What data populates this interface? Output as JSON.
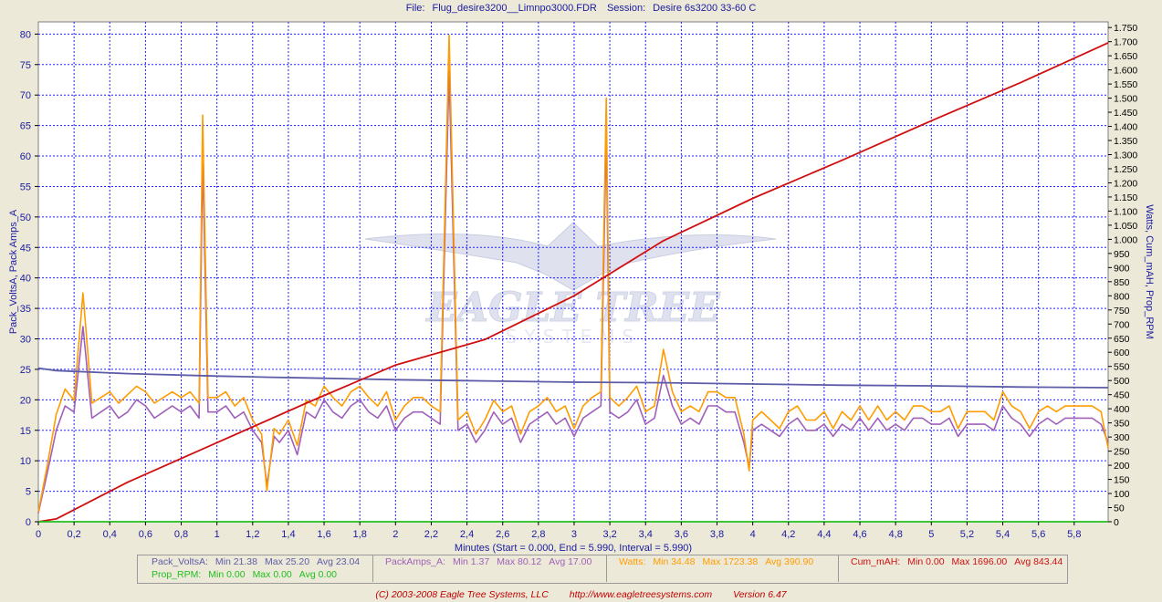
{
  "header": {
    "file_label": "File:",
    "file_name": "Flug_desire3200__Limnpo3000.FDR",
    "session_label": "Session:",
    "session_name": "Desire 6s3200 33-60 C"
  },
  "colors": {
    "volts": "#5c5ca8",
    "amps": "#a060b8",
    "watts": "#ff9c00",
    "mah": "#d01010",
    "rpm": "#20c020",
    "grid": "#2020ff",
    "axis_text": "#1a1aa0",
    "plot_bg": "#ffffff",
    "window_bg": "#ece9d8"
  },
  "chart_data": {
    "type": "line",
    "title": "",
    "xlabel": "Minutes (Start = 0.000,  End = 5.990,  Interval = 5.990)",
    "ylabel_left": "Pack_VoltsA, Pack Amps_A",
    "ylabel_right": "Watts, Cum_mAH, Prop_RPM",
    "xlim": [
      0,
      5.99
    ],
    "ylim_left": [
      0,
      82
    ],
    "ylim_right": [
      0,
      1770
    ],
    "grid": true,
    "watermark": {
      "line1": "EAGLE TREE",
      "line2": "SYSTEMS"
    },
    "x_ticks": [
      "0",
      "0,2",
      "0,4",
      "0,6",
      "0,8",
      "1",
      "1,2",
      "1,4",
      "1,6",
      "1,8",
      "2",
      "2,2",
      "2,4",
      "2,6",
      "2,8",
      "3",
      "3,2",
      "3,4",
      "3,6",
      "3,8",
      "4",
      "4,2",
      "4,4",
      "4,6",
      "4,8",
      "5",
      "5,2",
      "5,4",
      "5,6",
      "5,8"
    ],
    "y_left_ticks": [
      "0",
      "5",
      "10",
      "15",
      "20",
      "25",
      "30",
      "35",
      "40",
      "45",
      "50",
      "55",
      "60",
      "65",
      "70",
      "75",
      "80"
    ],
    "y_right_ticks": [
      "0",
      "50",
      "100",
      "150",
      "200",
      "250",
      "300",
      "350",
      "400",
      "450",
      "500",
      "550",
      "600",
      "650",
      "700",
      "750",
      "800",
      "850",
      "900",
      "950",
      "1.000",
      "1.050",
      "1.100",
      "1.150",
      "1.200",
      "1.250",
      "1.300",
      "1.350",
      "1.400",
      "1.450",
      "1.500",
      "1.550",
      "1.600",
      "1.650",
      "1.700",
      "1.750"
    ],
    "series": [
      {
        "name": "Pack_VoltsA",
        "axis": "left",
        "x": [
          0,
          0.1,
          0.5,
          1.0,
          1.3,
          1.5,
          2.0,
          2.5,
          3.0,
          3.5,
          4.0,
          4.5,
          5.0,
          5.5,
          5.99
        ],
        "y": [
          25.2,
          24.8,
          24.3,
          23.9,
          23.7,
          23.6,
          23.3,
          23.1,
          22.9,
          22.8,
          22.6,
          22.4,
          22.3,
          22.1,
          22.0
        ]
      },
      {
        "name": "PackAmps_A",
        "axis": "left",
        "x": [
          0,
          0.05,
          0.1,
          0.15,
          0.2,
          0.25,
          0.3,
          0.35,
          0.4,
          0.45,
          0.5,
          0.55,
          0.6,
          0.65,
          0.7,
          0.75,
          0.8,
          0.85,
          0.9,
          0.92,
          0.95,
          1.0,
          1.05,
          1.1,
          1.15,
          1.2,
          1.25,
          1.28,
          1.32,
          1.35,
          1.4,
          1.45,
          1.5,
          1.55,
          1.6,
          1.65,
          1.7,
          1.75,
          1.8,
          1.85,
          1.9,
          1.95,
          2.0,
          2.05,
          2.1,
          2.15,
          2.2,
          2.25,
          2.3,
          2.35,
          2.4,
          2.45,
          2.5,
          2.55,
          2.6,
          2.65,
          2.7,
          2.75,
          2.8,
          2.85,
          2.9,
          2.95,
          3.0,
          3.05,
          3.1,
          3.15,
          3.18,
          3.2,
          3.25,
          3.3,
          3.35,
          3.4,
          3.45,
          3.5,
          3.55,
          3.6,
          3.65,
          3.7,
          3.75,
          3.8,
          3.85,
          3.9,
          3.95,
          3.98,
          4.0,
          4.05,
          4.1,
          4.15,
          4.2,
          4.25,
          4.3,
          4.35,
          4.4,
          4.45,
          4.5,
          4.55,
          4.6,
          4.65,
          4.7,
          4.75,
          4.8,
          4.85,
          4.9,
          4.95,
          5.0,
          5.05,
          5.1,
          5.15,
          5.2,
          5.25,
          5.3,
          5.35,
          5.4,
          5.45,
          5.5,
          5.55,
          5.6,
          5.65,
          5.7,
          5.75,
          5.8,
          5.85,
          5.9,
          5.95,
          5.99
        ],
        "y": [
          1.4,
          8,
          15,
          19,
          18,
          32,
          17,
          18,
          19,
          17,
          18,
          20,
          19,
          17,
          18,
          19,
          18,
          19,
          17,
          60,
          18,
          18,
          19,
          17,
          18,
          15,
          13,
          6,
          14,
          13,
          15,
          11,
          18,
          17,
          20,
          18,
          17,
          19,
          20,
          18,
          17,
          19,
          15,
          17,
          18,
          18,
          17,
          16,
          74,
          15,
          16,
          13,
          15,
          18,
          16,
          17,
          13,
          16,
          17,
          18,
          16,
          17,
          14,
          17,
          18,
          19,
          64,
          18,
          17,
          18,
          20,
          16,
          17,
          24,
          19,
          16,
          17,
          16,
          19,
          19,
          18,
          18,
          13,
          9,
          15,
          16,
          15,
          14,
          16,
          17,
          15,
          15,
          16,
          14,
          16,
          15,
          17,
          15,
          17,
          15,
          16,
          15,
          17,
          17,
          16,
          16,
          17,
          14,
          16,
          16,
          16,
          15,
          19,
          17,
          16,
          14,
          16,
          17,
          16,
          17,
          17,
          17,
          17,
          16,
          13
        ]
      },
      {
        "name": "Watts",
        "axis": "right",
        "x": [
          0,
          0.05,
          0.1,
          0.15,
          0.2,
          0.25,
          0.3,
          0.35,
          0.4,
          0.45,
          0.5,
          0.55,
          0.6,
          0.65,
          0.7,
          0.75,
          0.8,
          0.85,
          0.9,
          0.92,
          0.95,
          1.0,
          1.05,
          1.1,
          1.15,
          1.2,
          1.25,
          1.28,
          1.32,
          1.35,
          1.4,
          1.45,
          1.5,
          1.55,
          1.6,
          1.65,
          1.7,
          1.75,
          1.8,
          1.85,
          1.9,
          1.95,
          2.0,
          2.05,
          2.1,
          2.15,
          2.2,
          2.25,
          2.3,
          2.35,
          2.4,
          2.45,
          2.5,
          2.55,
          2.6,
          2.65,
          2.7,
          2.75,
          2.8,
          2.85,
          2.9,
          2.95,
          3.0,
          3.05,
          3.1,
          3.15,
          3.18,
          3.2,
          3.25,
          3.3,
          3.35,
          3.4,
          3.45,
          3.5,
          3.55,
          3.6,
          3.65,
          3.7,
          3.75,
          3.8,
          3.85,
          3.9,
          3.95,
          3.98,
          4.0,
          4.05,
          4.1,
          4.15,
          4.2,
          4.25,
          4.3,
          4.35,
          4.4,
          4.45,
          4.5,
          4.55,
          4.6,
          4.65,
          4.7,
          4.75,
          4.8,
          4.85,
          4.9,
          4.95,
          5.0,
          5.05,
          5.1,
          5.15,
          5.2,
          5.25,
          5.3,
          5.35,
          5.4,
          5.45,
          5.5,
          5.55,
          5.6,
          5.65,
          5.7,
          5.75,
          5.8,
          5.85,
          5.9,
          5.95,
          5.99
        ],
        "y": [
          35,
          200,
          380,
          470,
          430,
          810,
          420,
          440,
          460,
          420,
          450,
          480,
          460,
          420,
          440,
          460,
          440,
          460,
          420,
          1440,
          440,
          440,
          460,
          410,
          440,
          360,
          310,
          110,
          330,
          310,
          360,
          270,
          430,
          410,
          480,
          440,
          410,
          460,
          480,
          440,
          410,
          460,
          360,
          410,
          440,
          440,
          410,
          390,
          1723,
          360,
          390,
          310,
          360,
          430,
          390,
          410,
          310,
          390,
          410,
          440,
          390,
          410,
          330,
          410,
          440,
          460,
          1500,
          440,
          410,
          440,
          480,
          390,
          410,
          610,
          460,
          390,
          410,
          390,
          460,
          460,
          440,
          440,
          310,
          180,
          360,
          390,
          360,
          330,
          390,
          410,
          360,
          360,
          390,
          330,
          390,
          360,
          410,
          360,
          410,
          360,
          390,
          360,
          410,
          410,
          390,
          390,
          410,
          330,
          390,
          390,
          390,
          360,
          460,
          410,
          390,
          330,
          390,
          410,
          390,
          410,
          410,
          410,
          410,
          390,
          260
        ]
      },
      {
        "name": "Cum_mAH",
        "axis": "right",
        "x": [
          0,
          0.1,
          0.5,
          1.0,
          1.5,
          2.0,
          2.5,
          3.0,
          3.5,
          4.0,
          4.5,
          5.0,
          5.5,
          5.99
        ],
        "y": [
          0,
          10,
          140,
          280,
          420,
          555,
          645,
          800,
          995,
          1145,
          1280,
          1420,
          1555,
          1696
        ]
      },
      {
        "name": "Prop_RPM",
        "axis": "right",
        "x": [
          0,
          5.99
        ],
        "y": [
          0,
          0
        ]
      }
    ],
    "stats": [
      {
        "name": "Pack_VoltsA",
        "min": "Min 21.38",
        "max": "Max 25.20",
        "avg": "Avg 23.04"
      },
      {
        "name": "Prop_RPM",
        "min": "Min 0.00",
        "max": "Max 0.00",
        "avg": "Avg 0.00"
      },
      {
        "name": "PackAmps_A",
        "min": "Min 1.37",
        "max": "Max 80.12",
        "avg": "Avg 17.00"
      },
      {
        "name": "Watts",
        "min": "Min 34.48",
        "max": "Max 1723.38",
        "avg": "Avg 390.90"
      },
      {
        "name": "Cum_mAH",
        "min": "Min 0.00",
        "max": "Max 1696.00",
        "avg": "Avg 843.44"
      }
    ]
  },
  "legend": {
    "volts_label": "Pack_VoltsA:",
    "rpm_label": "Prop_RPM:",
    "amps_label": "PackAmps_A:",
    "watts_label": "Watts:",
    "mah_label": "Cum_mAH:"
  },
  "footer": {
    "copyright": "(C) 2003-2008 Eagle Tree Systems, LLC",
    "url": "http://www.eagletreesystems.com",
    "version": "Version 6.47"
  }
}
